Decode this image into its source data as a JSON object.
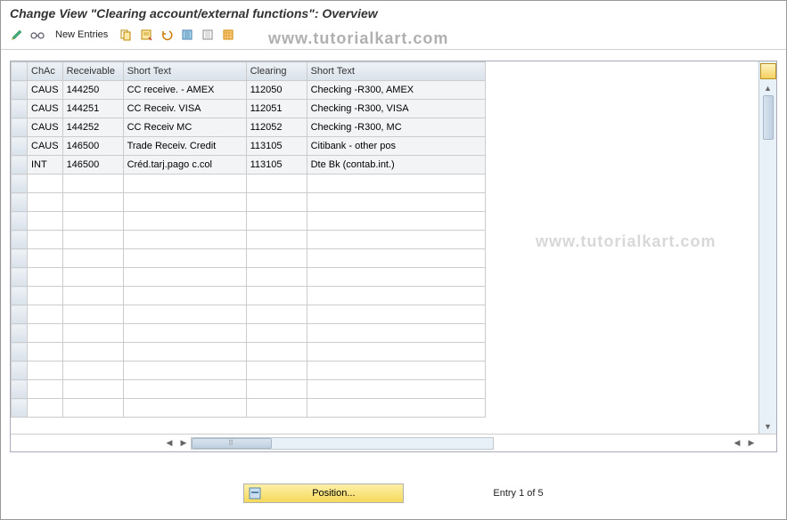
{
  "title": "Change View \"Clearing account/external functions\": Overview",
  "toolbar": {
    "new_entries_label": "New Entries"
  },
  "watermark": "www.tutorialkart.com",
  "table": {
    "headers": {
      "chac": "ChAc",
      "receivable": "Receivable",
      "short_text1": "Short Text",
      "clearing": "Clearing",
      "short_text2": "Short Text"
    },
    "rows": [
      {
        "chac": "CAUS",
        "receivable": "144250",
        "st1": "CC receive. -  AMEX",
        "clearing": "112050",
        "st2": "Checking -R300, AMEX"
      },
      {
        "chac": "CAUS",
        "receivable": "144251",
        "st1": "CC Receiv. VISA",
        "clearing": "112051",
        "st2": "Checking -R300, VISA"
      },
      {
        "chac": "CAUS",
        "receivable": "144252",
        "st1": "CC Receiv MC",
        "clearing": "112052",
        "st2": "Checking -R300, MC"
      },
      {
        "chac": "CAUS",
        "receivable": "146500",
        "st1": "Trade Receiv. Credit",
        "clearing": "113105",
        "st2": "Citibank - other pos"
      },
      {
        "chac": "INT",
        "receivable": "146500",
        "st1": "Créd.tarj.pago c.col",
        "clearing": "113105",
        "st2": "Dte Bk (contab.int.)"
      }
    ],
    "empty_rows": 13
  },
  "footer": {
    "position_label": "Position...",
    "entry_text": "Entry 1 of 5"
  }
}
